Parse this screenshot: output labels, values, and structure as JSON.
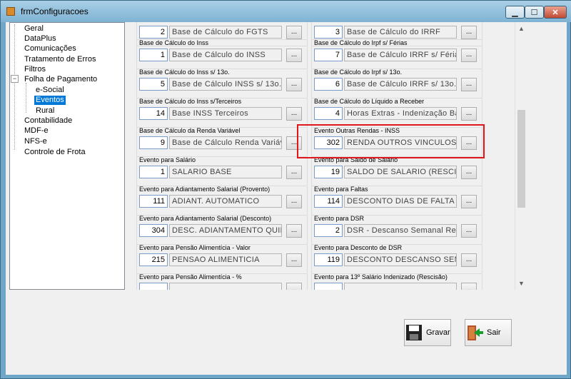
{
  "window": {
    "title": "frmConfiguracoes",
    "minimize": "▁",
    "maximize": "☐",
    "close": "✕"
  },
  "tree": {
    "items": [
      {
        "label": "Geral"
      },
      {
        "label": "DataPlus"
      },
      {
        "label": "Comunicações"
      },
      {
        "label": "Tratamento de Erros"
      },
      {
        "label": "Filtros"
      },
      {
        "label": "Folha de Pagamento",
        "expander": "−"
      },
      {
        "label": "e-Social"
      },
      {
        "label": "Eventos"
      },
      {
        "label": "Rural"
      },
      {
        "label": "Contabilidade"
      },
      {
        "label": "MDF-e"
      },
      {
        "label": "NFS-e"
      },
      {
        "label": "Controle de Frota"
      }
    ]
  },
  "groups": [
    {
      "label": "",
      "code": "2",
      "desc": "Base de Cálculo do FGTS"
    },
    {
      "label": "",
      "code": "3",
      "desc": "Base de Cálculo do IRRF"
    },
    {
      "label": "Base de Cálculo do Inss",
      "code": "1",
      "desc": "Base de Cálculo do INSS"
    },
    {
      "label": "Base de Cálculo do Irpf s/ Férias",
      "code": "7",
      "desc": "Base de Cálculo IRRF s/ Férias"
    },
    {
      "label": "Base de Cálculo do Inss s/ 13o.",
      "code": "5",
      "desc": "Base de Cálculo INSS s/ 13o."
    },
    {
      "label": "Base de Cálculo do Irpf s/ 13o.",
      "code": "6",
      "desc": "Base de Cálculo IRRF s/ 13o."
    },
    {
      "label": "Base de Cálculo do Inss s/Terceiros",
      "code": "14",
      "desc": "Base INSS Terceiros"
    },
    {
      "label": "Base de Cálculo do Líquido a Receber",
      "code": "4",
      "desc": "Horas Extras - Indenização Banc"
    },
    {
      "label": "Base de Cálculo da Renda Variável",
      "code": "9",
      "desc": "Base de Cálculo Renda Variáve"
    },
    {
      "label": "Evento Outras Rendas - INSS",
      "code": "302",
      "desc": "RENDA OUTROS VINCULOS"
    },
    {
      "label": "Evento para Salário",
      "code": "1",
      "desc": "SALARIO BASE"
    },
    {
      "label": "Evento para Saldo de Salário",
      "code": "19",
      "desc": "SALDO DE SALARIO (RESCISÃ"
    },
    {
      "label": "Evento para Adiantamento Salarial (Provento)",
      "code": "111",
      "desc": "ADIANT. AUTOMATICO"
    },
    {
      "label": "Evento para Faltas",
      "code": "114",
      "desc": "DESCONTO DIAS DE FALTA"
    },
    {
      "label": "Evento para Adiantamento Salarial (Desconto)",
      "code": "304",
      "desc": "DESC. ADIANTAMENTO QUINZ"
    },
    {
      "label": "Evento para DSR",
      "code": "2",
      "desc": "DSR - Descanso Semanal Rem"
    },
    {
      "label": "Evento para Pensão Alimentícia - Valor",
      "code": "215",
      "desc": "PENSAO ALIMENTICIA"
    },
    {
      "label": "Evento para Desconto de DSR",
      "code": "119",
      "desc": "DESCONTO DESCANSO SEMA"
    },
    {
      "label": "Evento para Pensão Alimentícia - %",
      "code": "",
      "desc": ""
    },
    {
      "label": "Evento para 13º Salário Indenizado (Rescisão)",
      "code": "",
      "desc": ""
    }
  ],
  "lookup_label": "...",
  "buttons": {
    "gravar": "Gravar",
    "sair": "Sair"
  },
  "colors": {
    "selection": "#0078d7",
    "highlight": "#e0161b",
    "titlebar": "#7fb3d3"
  }
}
